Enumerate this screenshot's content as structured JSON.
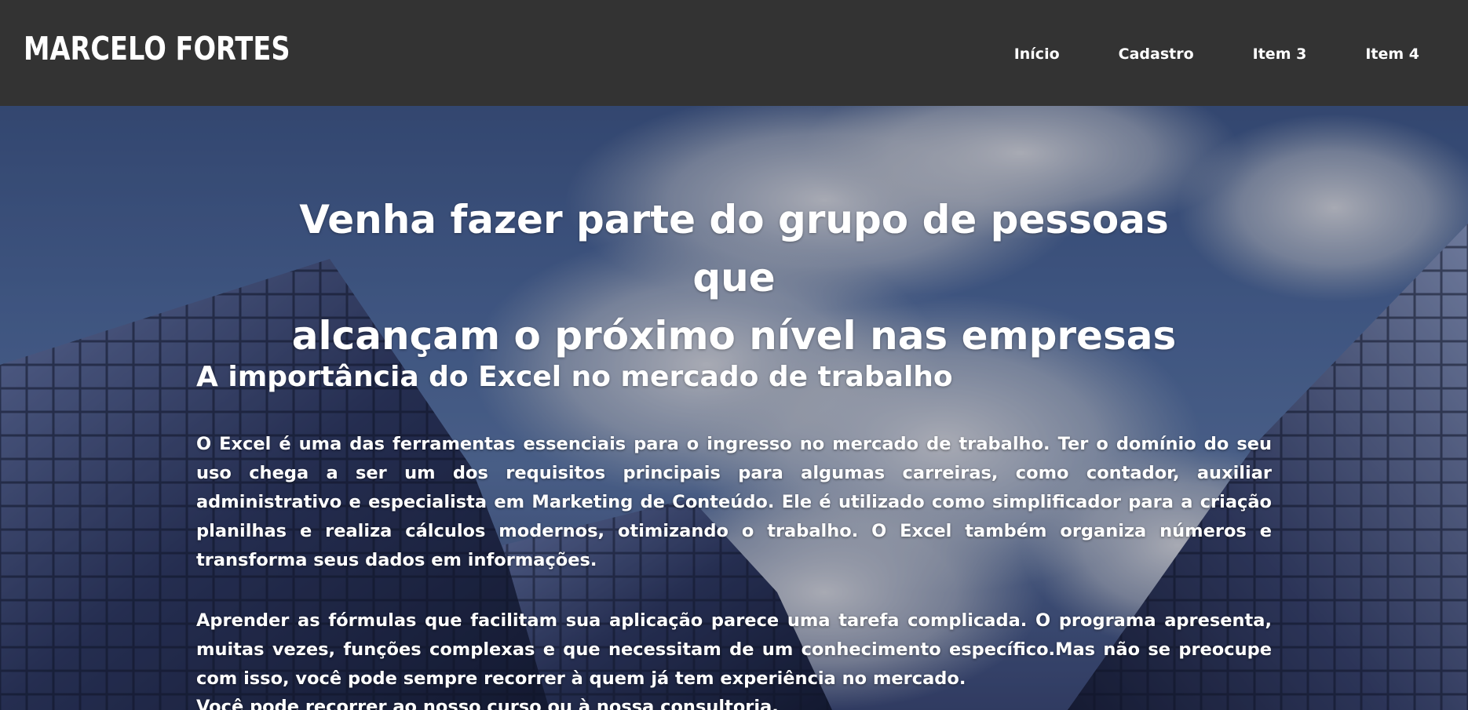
{
  "header": {
    "logo": "MARCELO FORTES",
    "nav": [
      {
        "label": "Início"
      },
      {
        "label": "Cadastro"
      },
      {
        "label": "Item 3"
      },
      {
        "label": "Item 4"
      }
    ]
  },
  "hero": {
    "title_line1": "Venha fazer parte do grupo de pessoas que",
    "title_line2": "alcançam o próximo nível nas empresas",
    "section_title": "A importância do Excel no mercado de trabalho",
    "paragraph1": "O Excel é uma das ferramentas essenciais para o ingresso no mercado de trabalho. Ter o domínio do seu uso chega a ser um dos requisitos principais para algumas carreiras, como contador, auxiliar administrativo e especialista em Marketing de Conteúdo. Ele é utilizado como simplificador para a criação planilhas e realiza cálculos modernos, otimizando o trabalho. O Excel também organiza números e transforma seus dados em informações.",
    "paragraph2": "Aprender as fórmulas que facilitam sua aplicação parece uma tarefa complicada. O programa apresenta, muitas vezes, funções complexas e que necessitam de um conhecimento específico.Mas não se preocupe com isso, você pode sempre recorrer à quem já tem experiência no mercado.",
    "paragraph3": "Você pode recorrer ao nosso curso ou à nossa consultoria."
  },
  "colors": {
    "header_bg": "#333333",
    "text": "#ffffff"
  }
}
